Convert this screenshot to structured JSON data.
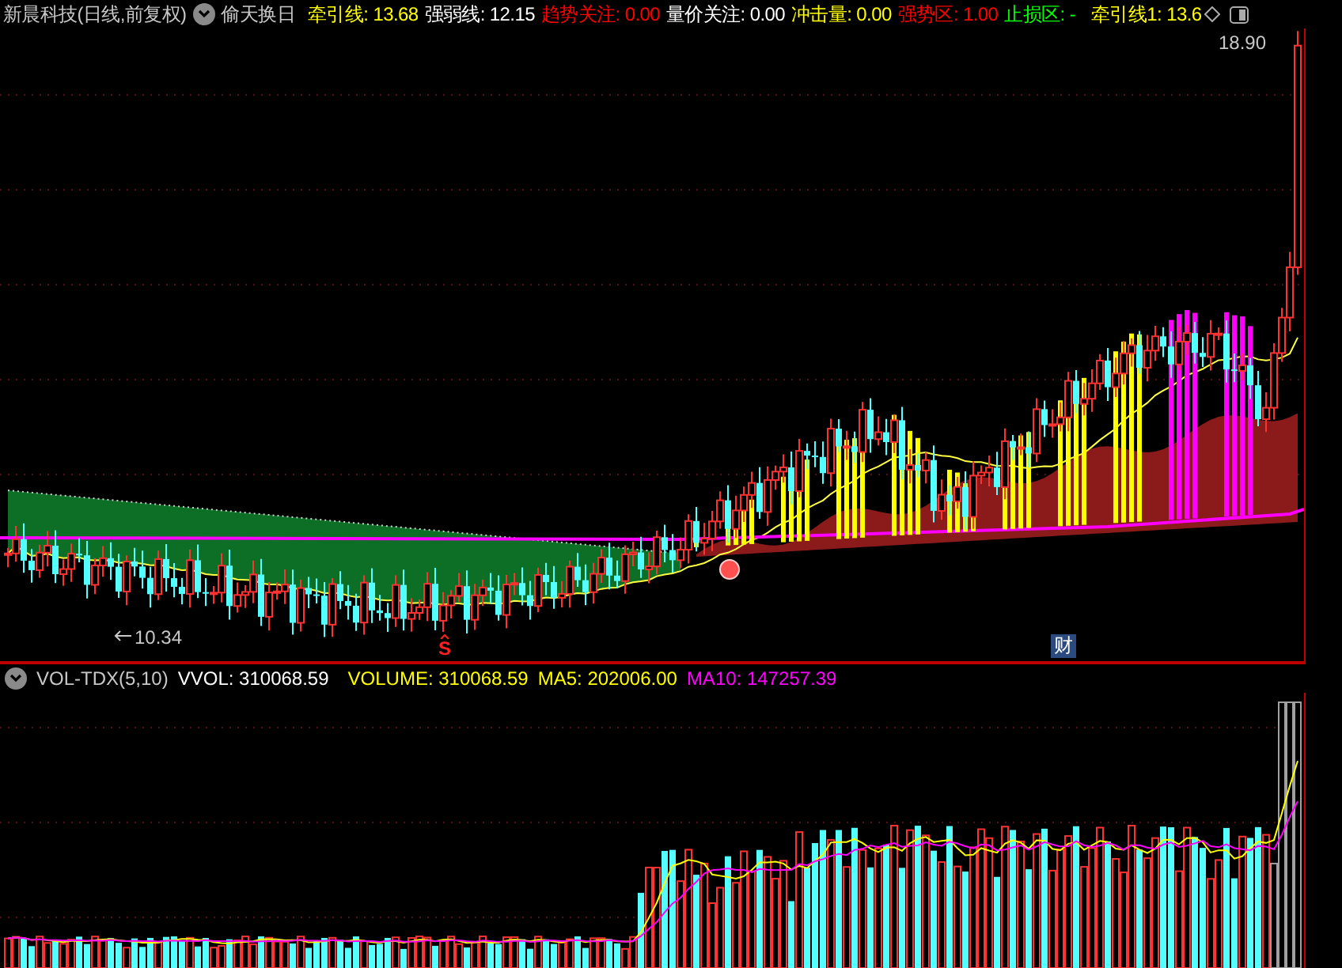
{
  "title": "新晨科技(日线,前复权)",
  "indicator_name": "偷天换日",
  "indicators": [
    {
      "text": "牵引线: 13.68",
      "color": "#ffff00"
    },
    {
      "text": "强弱线: 12.15",
      "color": "#ffffff"
    },
    {
      "text": "趋势关注: 0.00",
      "color": "#ff0000"
    },
    {
      "text": "量价关注: 0.00",
      "color": "#ffffff"
    },
    {
      "text": "冲击量: 0.00",
      "color": "#ffff00"
    },
    {
      "text": "强势区: 1.00",
      "color": "#ff0000"
    },
    {
      "text": "止损区: -",
      "color": "#00ff00"
    },
    {
      "text": "牵引线1: 13.6",
      "color": "#ffff00"
    }
  ],
  "chart": {
    "high_label": "18.90",
    "low_label": "10.34",
    "markers": [
      {
        "kind": "signal",
        "text": "S"
      },
      {
        "kind": "badge",
        "text": "财"
      }
    ]
  },
  "volume": {
    "name": "VOL-TDX(5,10)",
    "values": [
      {
        "text": "VVOL: 310068.59",
        "color": "#ffffff"
      },
      {
        "text": "VOLUME: 310068.59",
        "color": "#ffff00"
      },
      {
        "text": "MA5: 202006.00",
        "color": "#ffff00"
      },
      {
        "text": "MA10: 147257.39",
        "color": "#ff00ff"
      }
    ]
  }
}
